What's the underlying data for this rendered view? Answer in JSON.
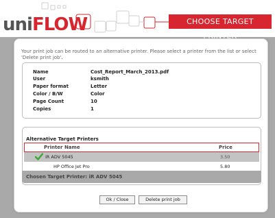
{
  "header": {
    "logo_uni": "uni",
    "logo_flow": "FLOW",
    "title": "CHOOSE TARGET PRINTER"
  },
  "intro_text": "Your print job can be routed to an alternative printer. Please select a printer from the list or select 'Delete print job'.",
  "job": {
    "rows": [
      {
        "label": "Name",
        "value": "Cost_Report_March_2013.pdf"
      },
      {
        "label": "User",
        "value": "ksmith"
      },
      {
        "label": "Paper format",
        "value": "Letter"
      },
      {
        "label": "Color / B/W",
        "value": "Color"
      },
      {
        "label": "Page Count",
        "value": "10"
      },
      {
        "label": "Copies",
        "value": "1"
      }
    ]
  },
  "printers": {
    "title": "Alternative Target Printers",
    "col_name": "Printer Name",
    "col_price": "Price",
    "rows": [
      {
        "name": "iR ADV 5045",
        "price": "3.50",
        "selected": true
      },
      {
        "name": "HP Office Jet Pro",
        "price": "5.80",
        "selected": false
      }
    ],
    "chosen_text": "Chosen Target Printer: iR ADV 5045"
  },
  "buttons": {
    "ok": "Ok / Close",
    "delete": "Delete print job"
  },
  "colors": {
    "brand_red": "#d7262f",
    "check_green": "#3aa832"
  }
}
